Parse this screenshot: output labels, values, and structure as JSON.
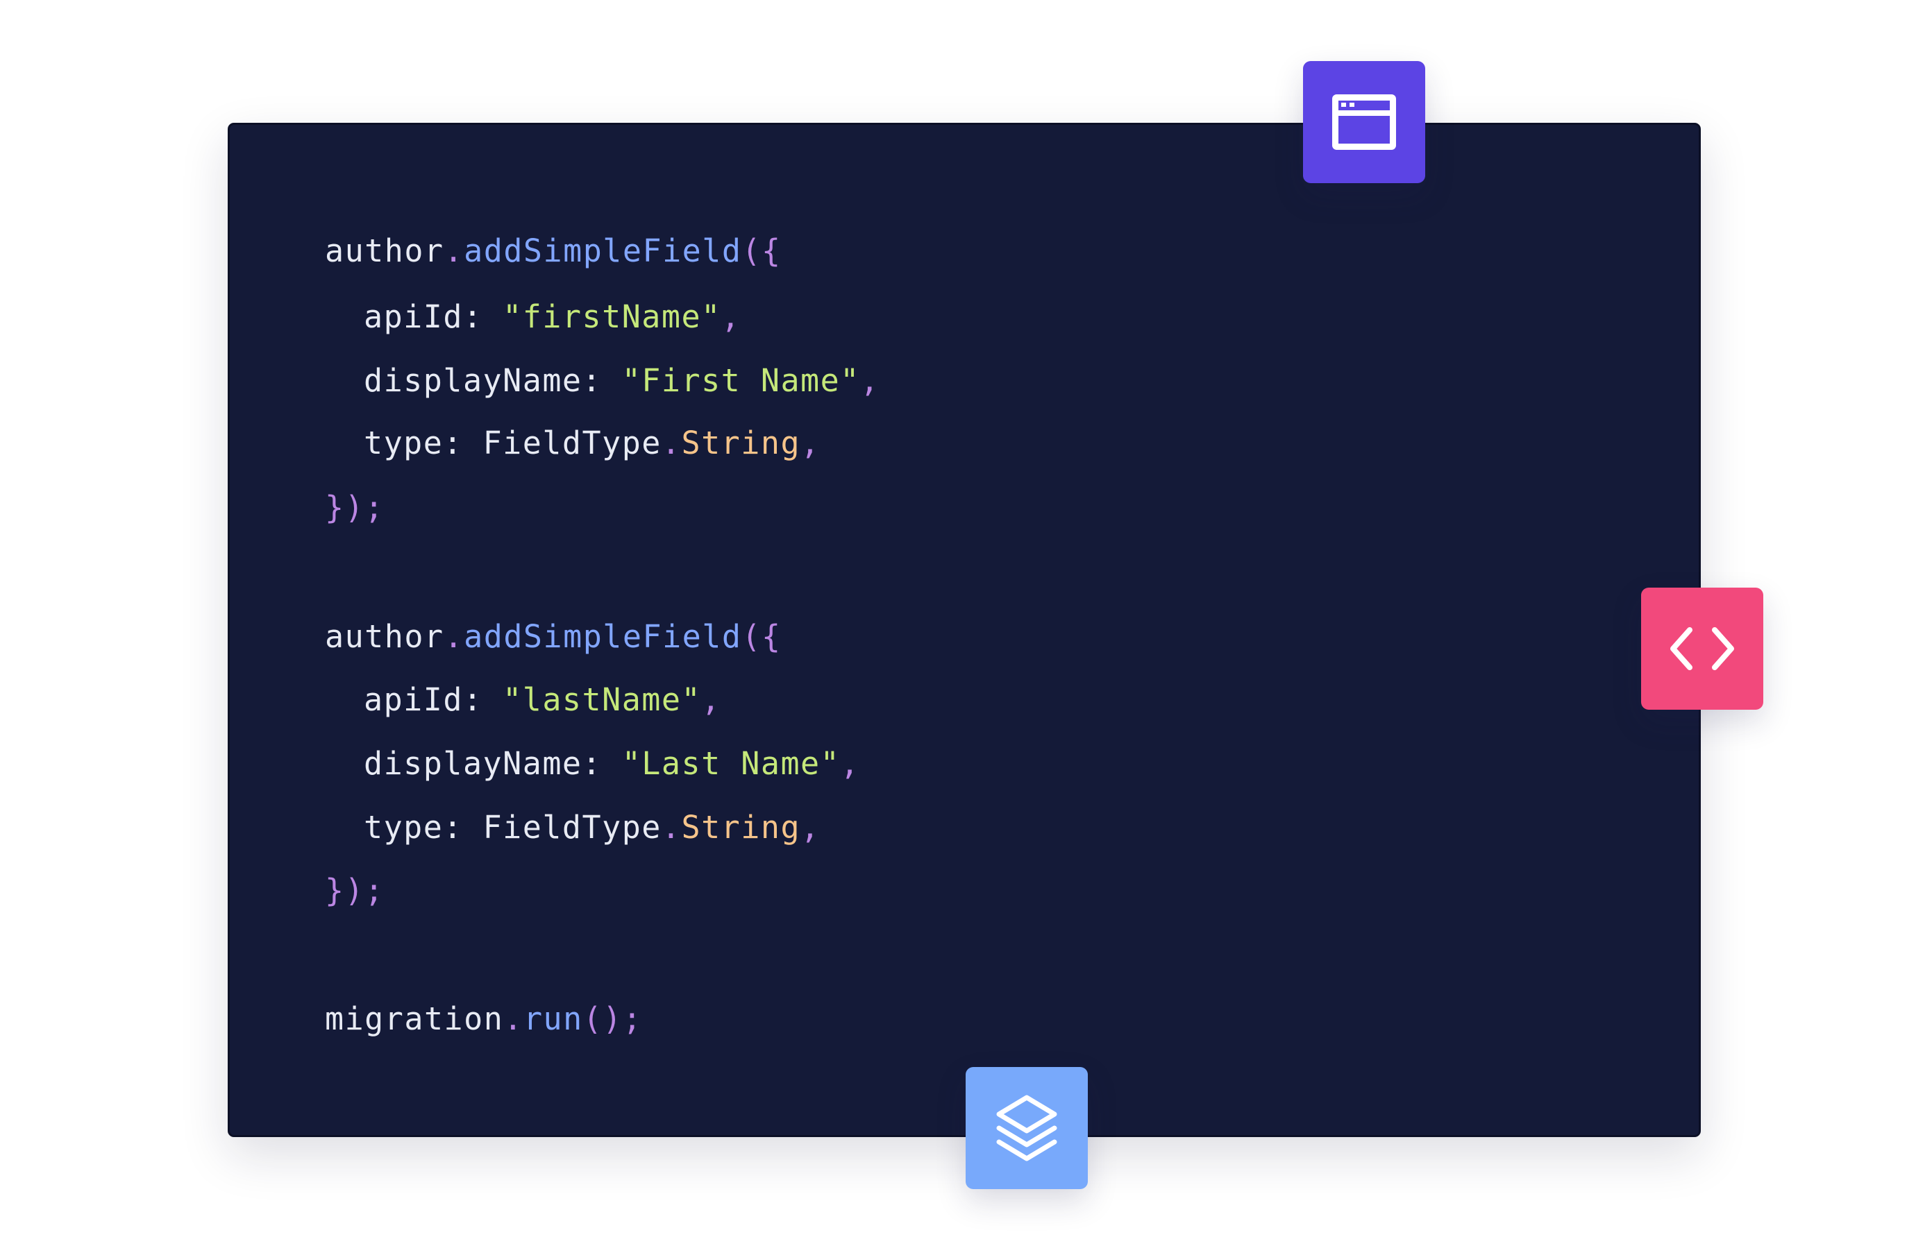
{
  "code_lines": [
    {
      "indent": false,
      "tokens": [
        {
          "t": "author",
          "c": "plain"
        },
        {
          "t": ".",
          "c": "punct"
        },
        {
          "t": "addSimpleField",
          "c": "method"
        },
        {
          "t": "({",
          "c": "punct"
        }
      ]
    },
    {
      "indent": true,
      "tokens": [
        {
          "t": "apiId: ",
          "c": "plain"
        },
        {
          "t": "\"firstName\"",
          "c": "str"
        },
        {
          "t": ",",
          "c": "punct"
        }
      ]
    },
    {
      "indent": true,
      "tokens": [
        {
          "t": "displayName: ",
          "c": "plain"
        },
        {
          "t": "\"First Name\"",
          "c": "str"
        },
        {
          "t": ",",
          "c": "punct"
        }
      ]
    },
    {
      "indent": true,
      "tokens": [
        {
          "t": "type: ",
          "c": "plain"
        },
        {
          "t": "FieldType",
          "c": "plain"
        },
        {
          "t": ".",
          "c": "punct"
        },
        {
          "t": "String",
          "c": "prop"
        },
        {
          "t": ",",
          "c": "punct"
        }
      ]
    },
    {
      "indent": false,
      "tokens": [
        {
          "t": "});",
          "c": "punct"
        }
      ]
    },
    {
      "indent": false,
      "tokens": [
        {
          "t": "author",
          "c": "plain"
        },
        {
          "t": ".",
          "c": "punct"
        },
        {
          "t": "addSimpleField",
          "c": "method"
        },
        {
          "t": "({",
          "c": "punct"
        }
      ]
    },
    {
      "indent": true,
      "tokens": [
        {
          "t": "apiId: ",
          "c": "plain"
        },
        {
          "t": "\"lastName\"",
          "c": "str"
        },
        {
          "t": ",",
          "c": "punct"
        }
      ]
    },
    {
      "indent": true,
      "tokens": [
        {
          "t": "displayName: ",
          "c": "plain"
        },
        {
          "t": "\"Last Name\"",
          "c": "str"
        },
        {
          "t": ",",
          "c": "punct"
        }
      ]
    },
    {
      "indent": true,
      "tokens": [
        {
          "t": "type: ",
          "c": "plain"
        },
        {
          "t": "FieldType",
          "c": "plain"
        },
        {
          "t": ".",
          "c": "punct"
        },
        {
          "t": "String",
          "c": "prop"
        },
        {
          "t": ",",
          "c": "punct"
        }
      ]
    },
    {
      "indent": false,
      "tokens": [
        {
          "t": "});",
          "c": "punct"
        }
      ]
    },
    {
      "indent": false,
      "tokens": [
        {
          "t": "migration",
          "c": "plain"
        },
        {
          "t": ".",
          "c": "punct"
        },
        {
          "t": "run",
          "c": "method"
        },
        {
          "t": "();",
          "c": "punct"
        }
      ]
    }
  ],
  "badges": {
    "window": {
      "icon": "browser-window-icon",
      "color": "#5c44e4"
    },
    "code": {
      "icon": "code-brackets-icon",
      "color": "#f2497c"
    },
    "layers": {
      "icon": "layers-icon",
      "color": "#78a9fb"
    }
  },
  "colors": {
    "card_background": "#141a38",
    "page_background": "#ffffff",
    "syntax_plain": "#e8ebf4",
    "syntax_method": "#82a6ff",
    "syntax_punctuation": "#bb86e3",
    "syntax_string": "#c5e87a",
    "syntax_property": "#f6c48a"
  }
}
